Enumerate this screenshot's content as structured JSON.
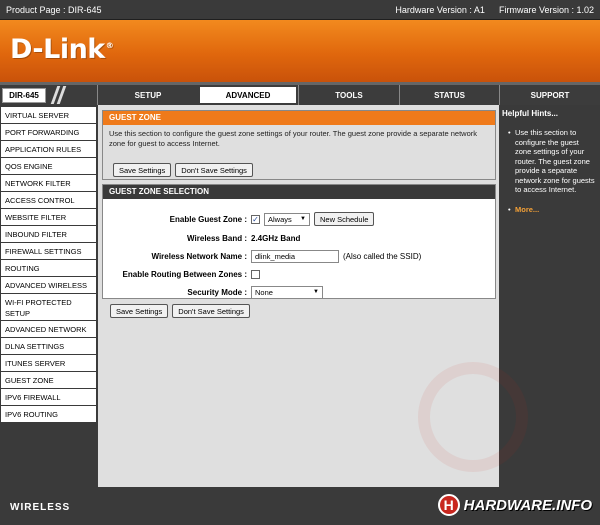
{
  "topbar": {
    "product": "Product Page : DIR-645",
    "hardware": "Hardware Version : A1",
    "firmware": "Firmware Version : 1.02"
  },
  "brand": {
    "logo": "D-Link",
    "logo_mark": "®"
  },
  "nav": {
    "model": "DIR-645",
    "tabs": [
      {
        "label": "SETUP"
      },
      {
        "label": "ADVANCED"
      },
      {
        "label": "TOOLS"
      },
      {
        "label": "STATUS"
      },
      {
        "label": "SUPPORT"
      }
    ],
    "active_tab": "ADVANCED"
  },
  "menu": {
    "items": [
      "VIRTUAL SERVER",
      "PORT FORWARDING",
      "APPLICATION RULES",
      "QOS ENGINE",
      "NETWORK FILTER",
      "ACCESS CONTROL",
      "WEBSITE FILTER",
      "INBOUND FILTER",
      "FIREWALL SETTINGS",
      "ROUTING",
      "ADVANCED WIRELESS",
      "WI-FI PROTECTED SETUP",
      "ADVANCED NETWORK",
      "DLNA SETTINGS",
      "ITUNES SERVER",
      "GUEST ZONE",
      "IPV6 FIREWALL",
      "IPV6 ROUTING"
    ],
    "selected": "GUEST ZONE"
  },
  "guest_zone": {
    "title": "GUEST ZONE",
    "description": "Use this section to configure the guest zone settings of your router. The guest zone provide a separate network zone for guest to access Internet.",
    "save_label": "Save Settings",
    "dont_save_label": "Don't Save Settings"
  },
  "selection": {
    "title": "GUEST ZONE SELECTION",
    "enable_label": "Enable Guest Zone :",
    "enable_checked": true,
    "schedule_value": "Always",
    "new_schedule_label": "New Schedule",
    "band_label": "Wireless Band :",
    "band_value": "2.4GHz Band",
    "ssid_label": "Wireless Network Name :",
    "ssid_value": "dlink_media",
    "ssid_note": "(Also called the SSID)",
    "routing_label": "Enable Routing Between Zones :",
    "routing_checked": false,
    "security_label": "Security Mode :",
    "security_value": "None"
  },
  "bottom": {
    "save_label": "Save Settings",
    "dont_save_label": "Don't Save Settings"
  },
  "hints": {
    "title": "Helpful Hints...",
    "text": "Use this section to configure the guest zone settings of your router. The guest zone provide a separate network zone for guests to access Internet.",
    "more": "More..."
  },
  "footer": {
    "label": "WIRELESS",
    "watermark": "HARDWARE.INFO",
    "watermark_badge": "H"
  },
  "colors": {
    "orange": "#ef7a1a",
    "dark": "#3a3a3a",
    "panel": "#dfdfdf",
    "hint_link": "#f3a037"
  }
}
